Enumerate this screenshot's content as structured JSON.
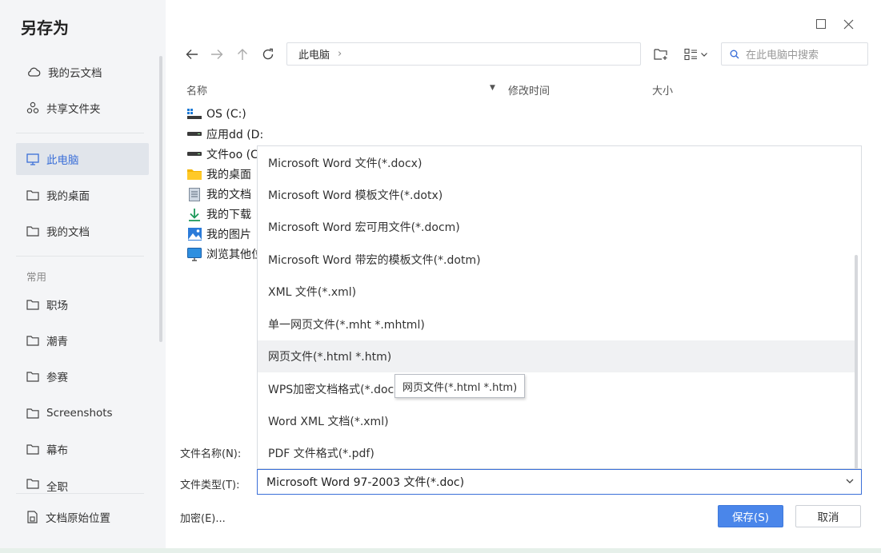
{
  "dialog": {
    "title": "另存为"
  },
  "sidebar": {
    "items": [
      {
        "label": "我的云文档",
        "icon": "cloud-icon"
      },
      {
        "label": "共享文件夹",
        "icon": "share-icon"
      },
      {
        "label": "此电脑",
        "icon": "monitor-icon",
        "active": true
      },
      {
        "label": "我的桌面",
        "icon": "folder-icon"
      },
      {
        "label": "我的文档",
        "icon": "folder-icon"
      }
    ],
    "group_label": "常用",
    "common": [
      {
        "label": "职场",
        "icon": "folder-icon"
      },
      {
        "label": "潮青",
        "icon": "folder-icon"
      },
      {
        "label": "参赛",
        "icon": "folder-icon"
      },
      {
        "label": "Screenshots",
        "icon": "folder-icon"
      },
      {
        "label": "幕布",
        "icon": "folder-icon"
      },
      {
        "label": "全职",
        "icon": "folder-icon"
      }
    ],
    "doc_origin": "文档原始位置"
  },
  "address": {
    "path": "此电脑",
    "chevron": "›"
  },
  "search": {
    "placeholder": "在此电脑中搜索"
  },
  "columns": {
    "name": "名称",
    "modified": "修改时间",
    "size": "大小"
  },
  "files": [
    {
      "name": "OS (C:)",
      "icon": "windows-drive-icon"
    },
    {
      "name": "应用dd (D:)",
      "icon": "drive-icon"
    },
    {
      "name": "文件oo (C",
      "icon": "drive-icon"
    },
    {
      "name": "我的桌面",
      "icon": "desktop-folder-icon"
    },
    {
      "name": "我的文档",
      "icon": "documents-icon"
    },
    {
      "name": "我的下载",
      "icon": "download-icon"
    },
    {
      "name": "我的图片",
      "icon": "pictures-icon"
    },
    {
      "name": "浏览其他位",
      "icon": "computer-icon"
    }
  ],
  "dropdown": {
    "options": [
      "Microsoft Word 文件(*.docx)",
      "Microsoft Word 模板文件(*.dotx)",
      "Microsoft Word 宏可用文件(*.docm)",
      "Microsoft Word 带宏的模板文件(*.dotm)",
      "XML 文件(*.xml)",
      "单一网页文件(*.mht *.mhtml)",
      "网页文件(*.html *.htm)",
      "WPS加密文档格式(*.docx)",
      "Word XML 文档(*.xml)",
      "PDF 文件格式(*.pdf)"
    ],
    "hovered_index": 6,
    "tooltip": "网页文件(*.html *.htm)"
  },
  "form": {
    "filename_label": "文件名称(N):",
    "filetype_label": "文件类型(T):",
    "filetype_value": "Microsoft Word 97-2003 文件(*.doc)",
    "encrypt_label": "加密(E)..."
  },
  "buttons": {
    "save": "保存(S)",
    "cancel": "取消"
  },
  "colors": {
    "accent": "#4a86ea",
    "active_text": "#3b6fd8",
    "sidebar_bg": "#f4f5f7"
  }
}
